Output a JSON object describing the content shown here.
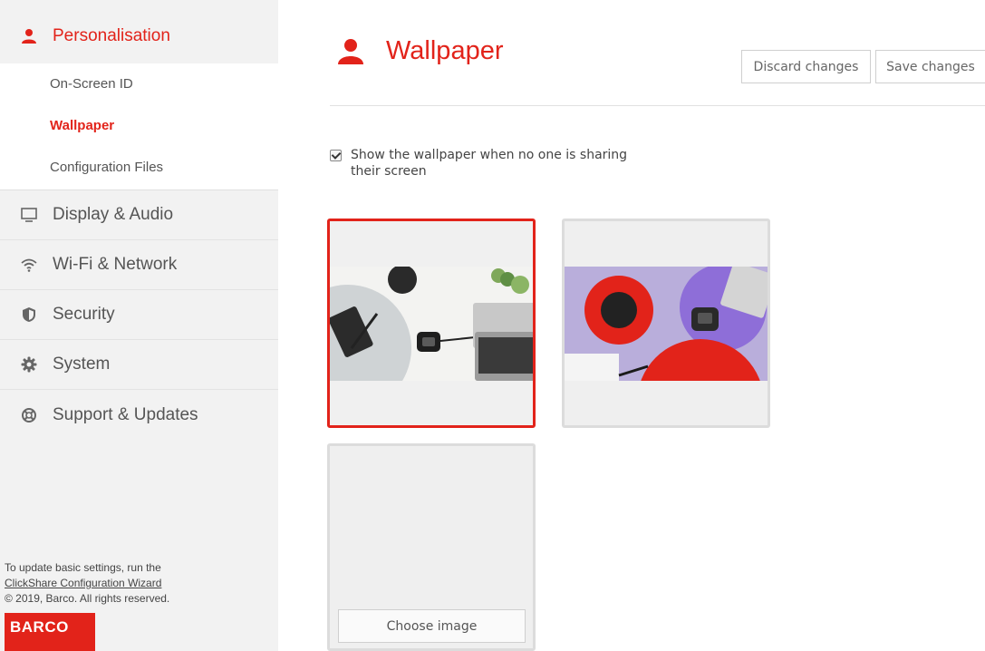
{
  "sidebar": {
    "section_title": "Personalisation",
    "sub_items": [
      {
        "label": "On-Screen ID",
        "active": false
      },
      {
        "label": "Wallpaper",
        "active": true
      },
      {
        "label": "Configuration Files",
        "active": false
      }
    ],
    "menu_items": [
      {
        "label": "Display & Audio",
        "icon": "monitor-icon"
      },
      {
        "label": "Wi-Fi & Network",
        "icon": "wifi-icon"
      },
      {
        "label": "Security",
        "icon": "shield-icon"
      },
      {
        "label": "System",
        "icon": "gear-icon"
      },
      {
        "label": "Support & Updates",
        "icon": "lifebuoy-icon"
      }
    ],
    "footer": {
      "line1": "To update basic settings, run the",
      "link": "ClickShare Configuration Wizard",
      "copyright": "© 2019, Barco. All rights reserved."
    },
    "logo_text": "BARCO"
  },
  "main": {
    "title": "Wallpaper",
    "discard_label": "Discard changes",
    "save_label": "Save changes",
    "checkbox_label": "Show the wallpaper when no one is sharing their screen",
    "checkbox_checked": true,
    "choose_image_label": "Choose image"
  },
  "colors": {
    "accent": "#e2231a",
    "sidebar_bg": "#f2f2f2",
    "text": "#555555"
  }
}
